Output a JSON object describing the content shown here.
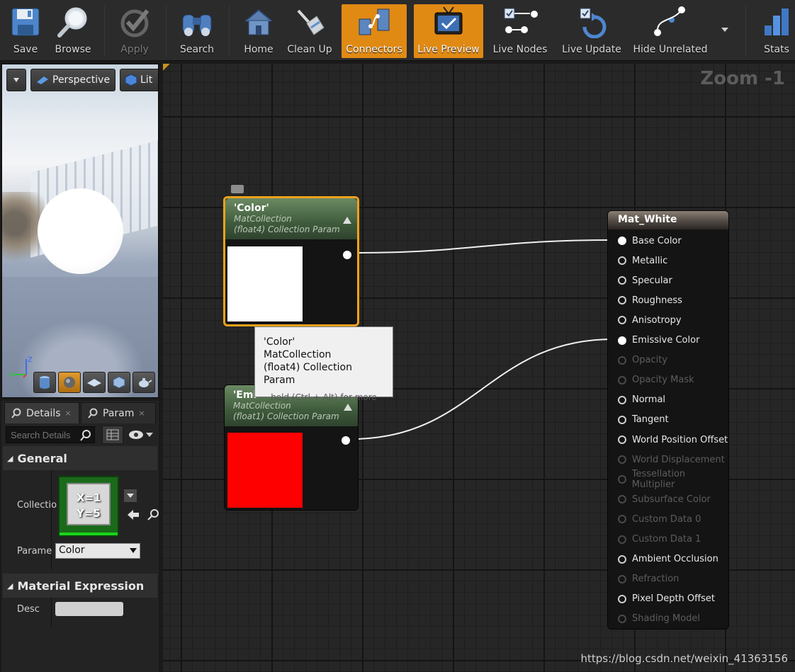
{
  "toolbar": {
    "buttons": [
      {
        "label": "Save",
        "icon": "floppy-disk-icon",
        "state": "normal"
      },
      {
        "label": "Browse",
        "icon": "magnifier-icon",
        "state": "normal"
      },
      {
        "label": "Apply",
        "icon": "checkmark-icon",
        "state": "disabled"
      },
      {
        "label": "Search",
        "icon": "binoculars-icon",
        "state": "normal"
      },
      {
        "label": "Home",
        "icon": "house-icon",
        "state": "normal"
      },
      {
        "label": "Clean Up",
        "icon": "broom-icon",
        "state": "normal"
      },
      {
        "label": "Connectors",
        "icon": "connectors-icon",
        "state": "active"
      },
      {
        "label": "Live Preview",
        "icon": "tv-icon",
        "state": "active"
      },
      {
        "label": "Live Nodes",
        "icon": "live-nodes-icon",
        "state": "normal"
      },
      {
        "label": "Live Update",
        "icon": "refresh-icon",
        "state": "normal"
      },
      {
        "label": "Hide Unrelated",
        "icon": "hide-unrelated-icon",
        "state": "normal"
      },
      {
        "label": "Stats",
        "icon": "bar-chart-icon",
        "state": "normal"
      }
    ]
  },
  "viewport": {
    "perspective_label": "Perspective",
    "lit_label": "Lit",
    "axis_z": "Z",
    "axis_y": "Y"
  },
  "details": {
    "tab_details": "Details",
    "tab_params": "Param",
    "search_placeholder": "Search Details",
    "section_general": "General",
    "collection_label": "Collectio",
    "collection_thumb_line1": "X=1",
    "collection_thumb_line2": "Y=5",
    "parameter_label": "Parame",
    "parameter_value": "Color",
    "section_material_expression": "Material Expression",
    "desc_label": "Desc"
  },
  "graph": {
    "zoom_label": "Zoom -1",
    "nodes": {
      "color": {
        "title": "'Color'",
        "line1": "MatCollection",
        "line2": "(float4) Collection Param",
        "preview": "#ffffff"
      },
      "emissive": {
        "title": "'Emi",
        "line1": "MatCollection",
        "line2": "(float1) Collection Param",
        "preview": "#ff0000"
      }
    },
    "result": {
      "title": "Mat_White",
      "pins": [
        {
          "label": "Base Color",
          "state": "connected"
        },
        {
          "label": "Metallic",
          "state": "on"
        },
        {
          "label": "Specular",
          "state": "on"
        },
        {
          "label": "Roughness",
          "state": "on"
        },
        {
          "label": "Anisotropy",
          "state": "on"
        },
        {
          "label": "Emissive Color",
          "state": "connected"
        },
        {
          "label": "Opacity",
          "state": "off"
        },
        {
          "label": "Opacity Mask",
          "state": "off"
        },
        {
          "label": "Normal",
          "state": "on"
        },
        {
          "label": "Tangent",
          "state": "on"
        },
        {
          "label": "World Position Offset",
          "state": "on"
        },
        {
          "label": "World Displacement",
          "state": "off"
        },
        {
          "label": "Tessellation Multiplier",
          "state": "off"
        },
        {
          "label": "Subsurface Color",
          "state": "off"
        },
        {
          "label": "Custom Data 0",
          "state": "off"
        },
        {
          "label": "Custom Data 1",
          "state": "off"
        },
        {
          "label": "Ambient Occlusion",
          "state": "on"
        },
        {
          "label": "Refraction",
          "state": "off"
        },
        {
          "label": "Pixel Depth Offset",
          "state": "on"
        },
        {
          "label": "Shading Model",
          "state": "off"
        }
      ]
    },
    "tooltip": {
      "line1": "'Color'",
      "line2": "MatCollection",
      "line3": "(float4) Collection Param",
      "hint": "hold (Ctrl + Alt) for more"
    }
  },
  "watermark": "https://blog.csdn.net/weixin_41363156"
}
